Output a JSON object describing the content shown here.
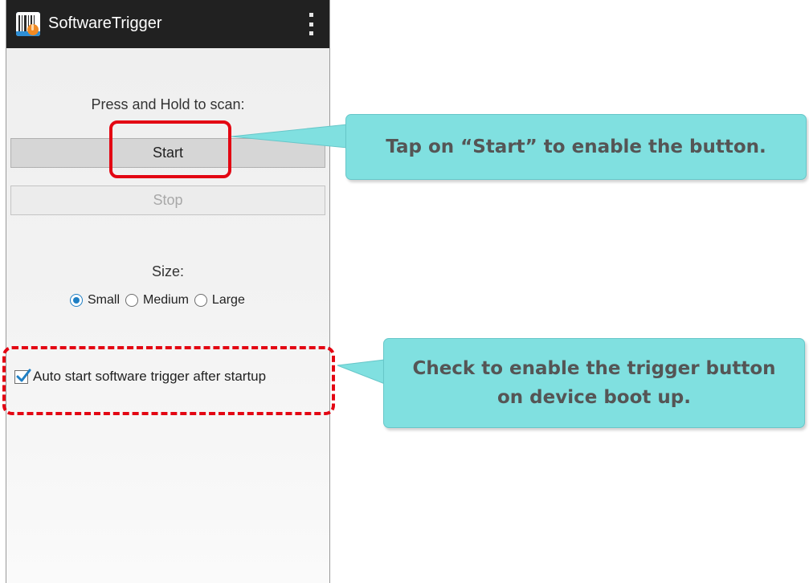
{
  "app": {
    "title": "SoftwareTrigger",
    "icon": "barcode-hand-icon",
    "overflow_icon": "overflow-menu-icon"
  },
  "scan": {
    "prompt": "Press and Hold to scan:",
    "start_label": "Start",
    "stop_label": "Stop",
    "stop_enabled": false
  },
  "size": {
    "label": "Size:",
    "options": [
      {
        "label": "Small",
        "checked": true
      },
      {
        "label": "Medium",
        "checked": false
      },
      {
        "label": "Large",
        "checked": false
      }
    ]
  },
  "auto_start": {
    "label": "Auto start software trigger after startup",
    "checked": true
  },
  "callouts": {
    "start_note": "Tap on “Start” to enable the button.",
    "auto_note_line1": "Check to enable the trigger button",
    "auto_note_line2": "on device boot up."
  },
  "colors": {
    "action_bar": "#212121",
    "accent": "#1f7fc4",
    "highlight": "#e30613",
    "callout_fill": "#80e0e0"
  }
}
